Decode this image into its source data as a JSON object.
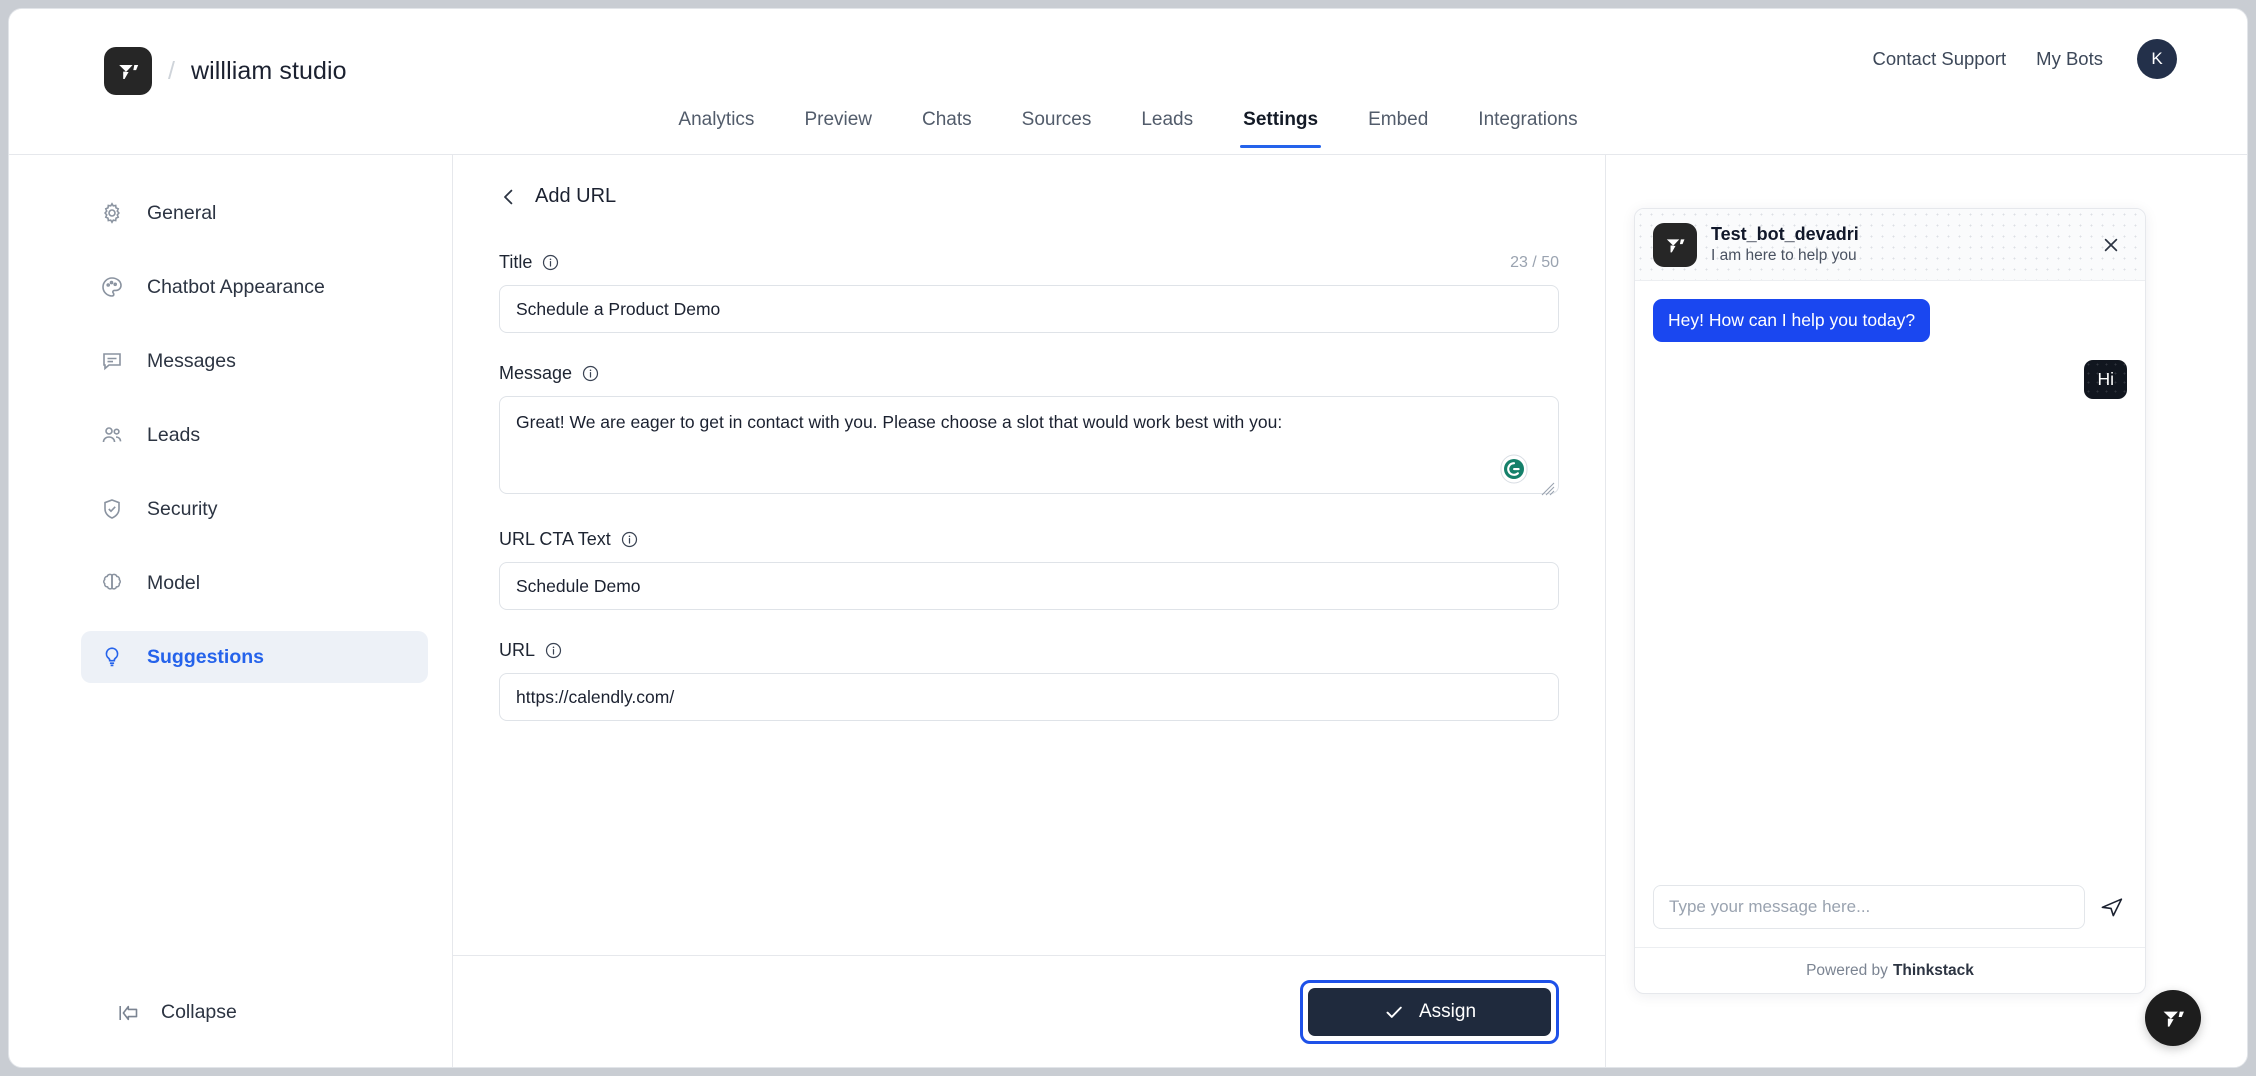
{
  "header": {
    "brand_separator": "/",
    "workspace_name": "willliam studio",
    "logo_icon": "thinkstack-logo-icon",
    "links": [
      {
        "label": "Contact Support",
        "name": "contact-support-link"
      },
      {
        "label": "My Bots",
        "name": "my-bots-link"
      }
    ],
    "avatar_initial": "K"
  },
  "tabs": [
    {
      "label": "Analytics",
      "active": false
    },
    {
      "label": "Preview",
      "active": false
    },
    {
      "label": "Chats",
      "active": false
    },
    {
      "label": "Sources",
      "active": false
    },
    {
      "label": "Leads",
      "active": false
    },
    {
      "label": "Settings",
      "active": true
    },
    {
      "label": "Embed",
      "active": false
    },
    {
      "label": "Integrations",
      "active": false
    }
  ],
  "sidebar": {
    "items": [
      {
        "label": "General",
        "icon": "gear-icon",
        "active": false
      },
      {
        "label": "Chatbot Appearance",
        "icon": "palette-icon",
        "active": false
      },
      {
        "label": "Messages",
        "icon": "message-icon",
        "active": false
      },
      {
        "label": "Leads",
        "icon": "users-icon",
        "active": false
      },
      {
        "label": "Security",
        "icon": "shield-check-icon",
        "active": false
      },
      {
        "label": "Model",
        "icon": "brain-icon",
        "active": false
      },
      {
        "label": "Suggestions",
        "icon": "lightbulb-icon",
        "active": true
      }
    ],
    "collapse_label": "Collapse",
    "collapse_icon": "collapse-left-icon"
  },
  "main": {
    "breadcrumb": "Add URL",
    "back_icon": "chevron-left-icon",
    "fields": {
      "title": {
        "label": "Title",
        "info_icon": "info-icon",
        "counter": "23 / 50",
        "value": "Schedule a Product Demo"
      },
      "message": {
        "label": "Message",
        "info_icon": "info-icon",
        "value": "Great! We are eager to get in contact with you. Please choose a slot that would work best with you:",
        "assistant_icon": "grammarly-icon",
        "resize_icon": "resize-grip-icon"
      },
      "cta": {
        "label": "URL CTA Text",
        "info_icon": "info-icon",
        "value": "Schedule Demo"
      },
      "url": {
        "label": "URL",
        "info_icon": "info-icon",
        "value": "https://calendly.com/"
      }
    },
    "assign_button": {
      "label": "Assign",
      "icon": "check-icon",
      "focused": true
    }
  },
  "chat_preview": {
    "bot_name": "Test_bot_devadri",
    "bot_tagline": "I am here to help you",
    "logo_icon": "thinkstack-logo-icon",
    "close_icon": "close-icon",
    "messages": [
      {
        "from": "bot",
        "text": "Hey! How can I help you today?"
      },
      {
        "from": "user",
        "text": "Hi"
      }
    ],
    "input_placeholder": "Type your message here...",
    "input_value": "",
    "send_icon": "send-icon",
    "footer_prefix": "Powered by",
    "footer_brand": "Thinkstack",
    "fab_icon": "thinkstack-logo-icon"
  },
  "colors": {
    "accent_blue": "#2563eb",
    "bubble_blue": "#1a47f0",
    "dark": "#1f2a3d",
    "focus_ring": "#1e51e8",
    "grammarly_green": "#15806a"
  }
}
